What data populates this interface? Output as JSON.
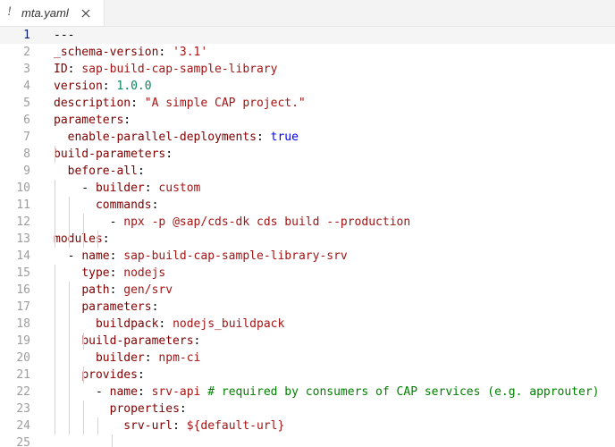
{
  "tab": {
    "icon_glyph": "!",
    "icon_name": "yaml-exclamation-icon",
    "filename": "mta.yaml",
    "close_glyph": "×"
  },
  "colors": {
    "key": "#800000",
    "string": "#a31515",
    "boolean": "#0000ff",
    "number": "#098658",
    "comment": "#008000",
    "line_number": "#9d9d9d",
    "active_line_number": "#0b216f"
  },
  "editor": {
    "active_line": 1,
    "lines": [
      {
        "n": "1",
        "tokens": [
          {
            "t": "---",
            "c": "p"
          }
        ]
      },
      {
        "n": "2",
        "tokens": [
          {
            "t": "_schema-version",
            "c": "k"
          },
          {
            "t": ": ",
            "c": "p"
          },
          {
            "t": "'3.1'",
            "c": "s"
          }
        ]
      },
      {
        "n": "3",
        "tokens": [
          {
            "t": "ID",
            "c": "k"
          },
          {
            "t": ": ",
            "c": "p"
          },
          {
            "t": "sap-build-cap-sample-library",
            "c": "s"
          }
        ]
      },
      {
        "n": "4",
        "tokens": [
          {
            "t": "version",
            "c": "k"
          },
          {
            "t": ": ",
            "c": "p"
          },
          {
            "t": "1.0.0",
            "c": "n"
          }
        ]
      },
      {
        "n": "5",
        "tokens": [
          {
            "t": "description",
            "c": "k"
          },
          {
            "t": ": ",
            "c": "p"
          },
          {
            "t": "\"A simple CAP project.\"",
            "c": "s"
          }
        ]
      },
      {
        "n": "6",
        "tokens": [
          {
            "t": "parameters",
            "c": "k"
          },
          {
            "t": ":",
            "c": "p"
          }
        ]
      },
      {
        "n": "7",
        "tokens": [
          {
            "t": "  ",
            "c": "p"
          },
          {
            "t": "enable-parallel-deployments",
            "c": "k"
          },
          {
            "t": ": ",
            "c": "p"
          },
          {
            "t": "true",
            "c": "b"
          }
        ]
      },
      {
        "n": "8",
        "tokens": [
          {
            "t": "build-parameters",
            "c": "k"
          },
          {
            "t": ":",
            "c": "p"
          }
        ]
      },
      {
        "n": "9",
        "tokens": [
          {
            "t": "  ",
            "c": "p"
          },
          {
            "t": "before-all",
            "c": "k"
          },
          {
            "t": ":",
            "c": "p"
          }
        ]
      },
      {
        "n": "10",
        "tokens": [
          {
            "t": "    - ",
            "c": "p"
          },
          {
            "t": "builder",
            "c": "k"
          },
          {
            "t": ": ",
            "c": "p"
          },
          {
            "t": "custom",
            "c": "s"
          }
        ]
      },
      {
        "n": "11",
        "tokens": [
          {
            "t": "      ",
            "c": "p"
          },
          {
            "t": "commands",
            "c": "k"
          },
          {
            "t": ":",
            "c": "p"
          }
        ]
      },
      {
        "n": "12",
        "tokens": [
          {
            "t": "        - ",
            "c": "p"
          },
          {
            "t": "npx -p @sap/cds-dk cds build --production",
            "c": "s"
          }
        ]
      },
      {
        "n": "13",
        "tokens": [
          {
            "t": "modules",
            "c": "k"
          },
          {
            "t": ":",
            "c": "p"
          }
        ]
      },
      {
        "n": "14",
        "tokens": [
          {
            "t": "  - ",
            "c": "p"
          },
          {
            "t": "name",
            "c": "k"
          },
          {
            "t": ": ",
            "c": "p"
          },
          {
            "t": "sap-build-cap-sample-library-srv",
            "c": "s"
          }
        ]
      },
      {
        "n": "15",
        "tokens": [
          {
            "t": "    ",
            "c": "p"
          },
          {
            "t": "type",
            "c": "k"
          },
          {
            "t": ": ",
            "c": "p"
          },
          {
            "t": "nodejs",
            "c": "s"
          }
        ]
      },
      {
        "n": "16",
        "tokens": [
          {
            "t": "    ",
            "c": "p"
          },
          {
            "t": "path",
            "c": "k"
          },
          {
            "t": ": ",
            "c": "p"
          },
          {
            "t": "gen/srv",
            "c": "s"
          }
        ]
      },
      {
        "n": "17",
        "tokens": [
          {
            "t": "    ",
            "c": "p"
          },
          {
            "t": "parameters",
            "c": "k"
          },
          {
            "t": ":",
            "c": "p"
          }
        ]
      },
      {
        "n": "18",
        "tokens": [
          {
            "t": "      ",
            "c": "p"
          },
          {
            "t": "buildpack",
            "c": "k"
          },
          {
            "t": ": ",
            "c": "p"
          },
          {
            "t": "nodejs_buildpack",
            "c": "s"
          }
        ]
      },
      {
        "n": "19",
        "tokens": [
          {
            "t": "    ",
            "c": "p"
          },
          {
            "t": "build-parameters",
            "c": "k"
          },
          {
            "t": ":",
            "c": "p"
          }
        ]
      },
      {
        "n": "20",
        "tokens": [
          {
            "t": "      ",
            "c": "p"
          },
          {
            "t": "builder",
            "c": "k"
          },
          {
            "t": ": ",
            "c": "p"
          },
          {
            "t": "npm-ci",
            "c": "s"
          }
        ]
      },
      {
        "n": "21",
        "tokens": [
          {
            "t": "    ",
            "c": "p"
          },
          {
            "t": "provides",
            "c": "k"
          },
          {
            "t": ":",
            "c": "p"
          }
        ]
      },
      {
        "n": "22",
        "tokens": [
          {
            "t": "      - ",
            "c": "p"
          },
          {
            "t": "name",
            "c": "k"
          },
          {
            "t": ": ",
            "c": "p"
          },
          {
            "t": "srv-api",
            "c": "s"
          },
          {
            "t": " # required by consumers of CAP services (e.g. approuter)",
            "c": "c"
          }
        ]
      },
      {
        "n": "23",
        "tokens": [
          {
            "t": "        ",
            "c": "p"
          },
          {
            "t": "properties",
            "c": "k"
          },
          {
            "t": ":",
            "c": "p"
          }
        ]
      },
      {
        "n": "24",
        "tokens": [
          {
            "t": "          ",
            "c": "p"
          },
          {
            "t": "srv-url",
            "c": "k"
          },
          {
            "t": ": ",
            "c": "p"
          },
          {
            "t": "${default-url}",
            "c": "s"
          }
        ]
      },
      {
        "n": "25",
        "tokens": []
      }
    ]
  }
}
